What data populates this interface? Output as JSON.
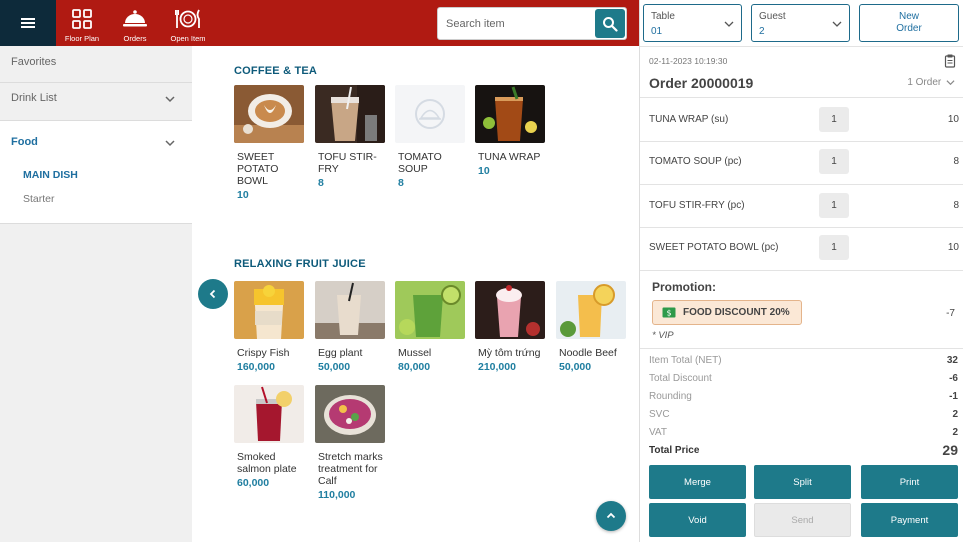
{
  "colors": {
    "topbar": "#b01a12",
    "menu_button_bg": "#0d2a3a",
    "accent": "#1e7a8a",
    "price_blue": "#1f7ea0",
    "section_title": "#0d5a7a"
  },
  "topbar": {
    "menu_icon": "hamburger-icon",
    "nav": [
      {
        "label": "Floor Plan",
        "icon": "floor-plan-icon"
      },
      {
        "label": "Orders",
        "icon": "orders-cloche-icon"
      },
      {
        "label": "Open Item",
        "icon": "open-item-plate-icon"
      }
    ],
    "search": {
      "placeholder": "Search item",
      "icon": "search-icon"
    }
  },
  "sidebar": {
    "favorites": "Favorites",
    "drink_list": "Drink List",
    "food": "Food",
    "food_children": [
      "MAIN DISH",
      "Starter"
    ]
  },
  "menu": {
    "sections": [
      {
        "title": "COFFEE & TEA",
        "items": [
          {
            "name": "SWEET POTATO BOWL",
            "price": "10",
            "image": "latte-photo"
          },
          {
            "name": "TOFU STIR-FRY",
            "price": "8",
            "image": "iced-coffee-photo"
          },
          {
            "name": "TOMATO SOUP",
            "price": "8",
            "image": "placeholder-dish-icon"
          },
          {
            "name": "TUNA WRAP",
            "price": "10",
            "image": "iced-tea-photo"
          }
        ]
      },
      {
        "title": "RELAXING FRUIT JUICE",
        "items": [
          {
            "name": "Crispy Fish",
            "price": "160,000",
            "image": "mango-chia-photo"
          },
          {
            "name": "Egg plant",
            "price": "50,000",
            "image": "milkshake-photo"
          },
          {
            "name": "Mussel",
            "price": "80,000",
            "image": "kiwi-smoothie-photo"
          },
          {
            "name": "Mỳ tôm trứng",
            "price": "210,000",
            "image": "strawberry-shake-photo"
          },
          {
            "name": "Noodle Beef",
            "price": "50,000",
            "image": "orange-juice-photo"
          },
          {
            "name": "Smoked salmon plate",
            "price": "60,000",
            "image": "berry-drink-photo"
          },
          {
            "name": "Stretch marks treatment for Calf",
            "price": "110,000",
            "image": "acai-bowl-photo"
          }
        ]
      }
    ]
  },
  "order": {
    "table_label": "Table",
    "table_value": "01",
    "guest_label": "Guest",
    "guest_value": "2",
    "new_order_line1": "New",
    "new_order_line2": "Order",
    "datetime": "02-11-2023 10:19:30",
    "order_number": "Order 20000019",
    "order_count": "1 Order",
    "items": [
      {
        "name": "TUNA WRAP (su)",
        "qty": "1",
        "price": "10"
      },
      {
        "name": "TOMATO SOUP (pc)",
        "qty": "1",
        "price": "8"
      },
      {
        "name": "TOFU STIR-FRY (pc)",
        "qty": "1",
        "price": "8"
      },
      {
        "name": "SWEET POTATO BOWL (pc)",
        "qty": "1",
        "price": "10"
      }
    ],
    "promotion": {
      "title": "Promotion:",
      "badge": "FOOD DISCOUNT 20%",
      "amount": "-7",
      "tag": "* VIP"
    },
    "totals": [
      {
        "label": "Item Total (NET)",
        "value": "32"
      },
      {
        "label": "Total Discount",
        "value": "-6"
      },
      {
        "label": "Rounding",
        "value": "-1"
      },
      {
        "label": "SVC",
        "value": "2"
      },
      {
        "label": "VAT",
        "value": "2"
      }
    ],
    "total_price_label": "Total Price",
    "total_price": "29",
    "actions": {
      "merge": "Merge",
      "split": "Split",
      "print": "Print",
      "void": "Void",
      "send": "Send",
      "payment": "Payment"
    }
  }
}
